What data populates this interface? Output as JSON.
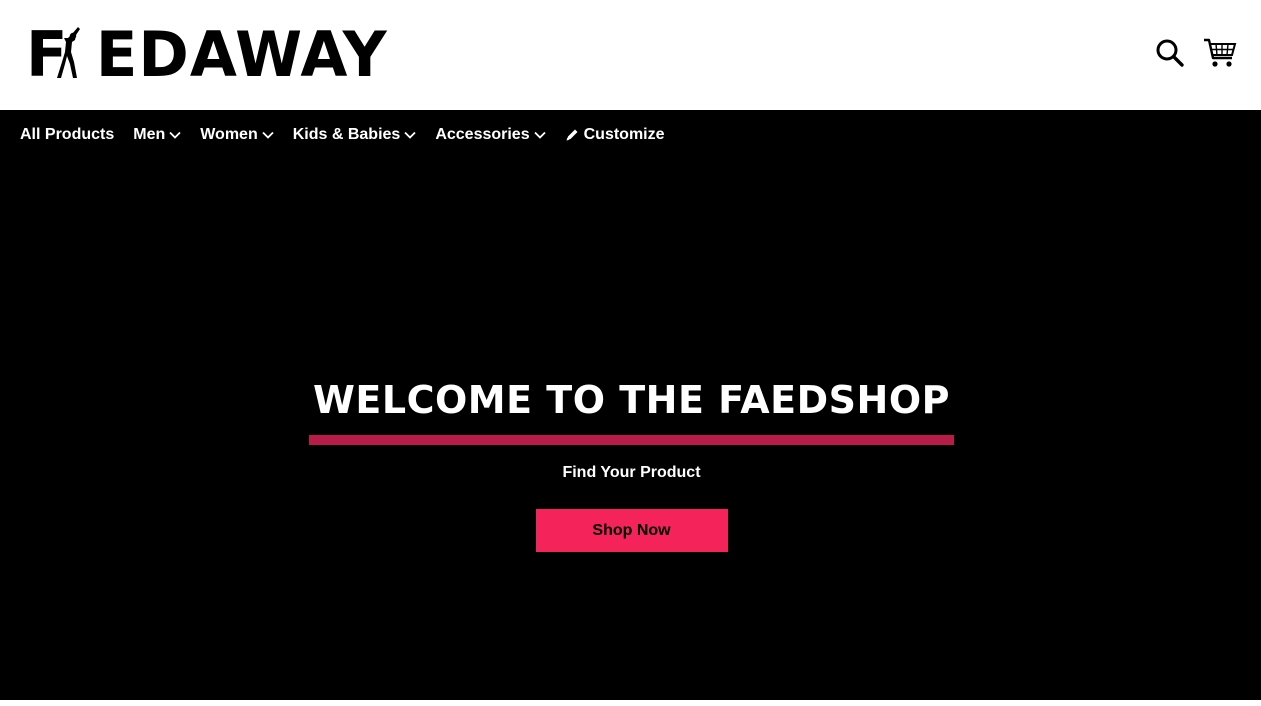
{
  "brand": {
    "logo_text": "FAEDAWAY"
  },
  "header": {
    "icons": {
      "search": "search-icon",
      "cart": "cart-icon"
    }
  },
  "nav": {
    "items": [
      {
        "label": "All Products",
        "has_dropdown": false
      },
      {
        "label": "Men",
        "has_dropdown": true
      },
      {
        "label": "Women",
        "has_dropdown": true
      },
      {
        "label": "Kids & Babies",
        "has_dropdown": true
      },
      {
        "label": "Accessories",
        "has_dropdown": true
      },
      {
        "label": "Customize",
        "has_dropdown": false,
        "icon": "pencil-icon"
      }
    ]
  },
  "hero": {
    "title": "WELCOME TO THE FAEDSHOP",
    "subtitle": "Find Your Product",
    "button_label": "Shop Now"
  },
  "colors": {
    "background": "#000000",
    "header_bg": "#ffffff",
    "accent_bar": "#b81c48",
    "button_bg": "#f4235a",
    "text_light": "#ffffff"
  }
}
